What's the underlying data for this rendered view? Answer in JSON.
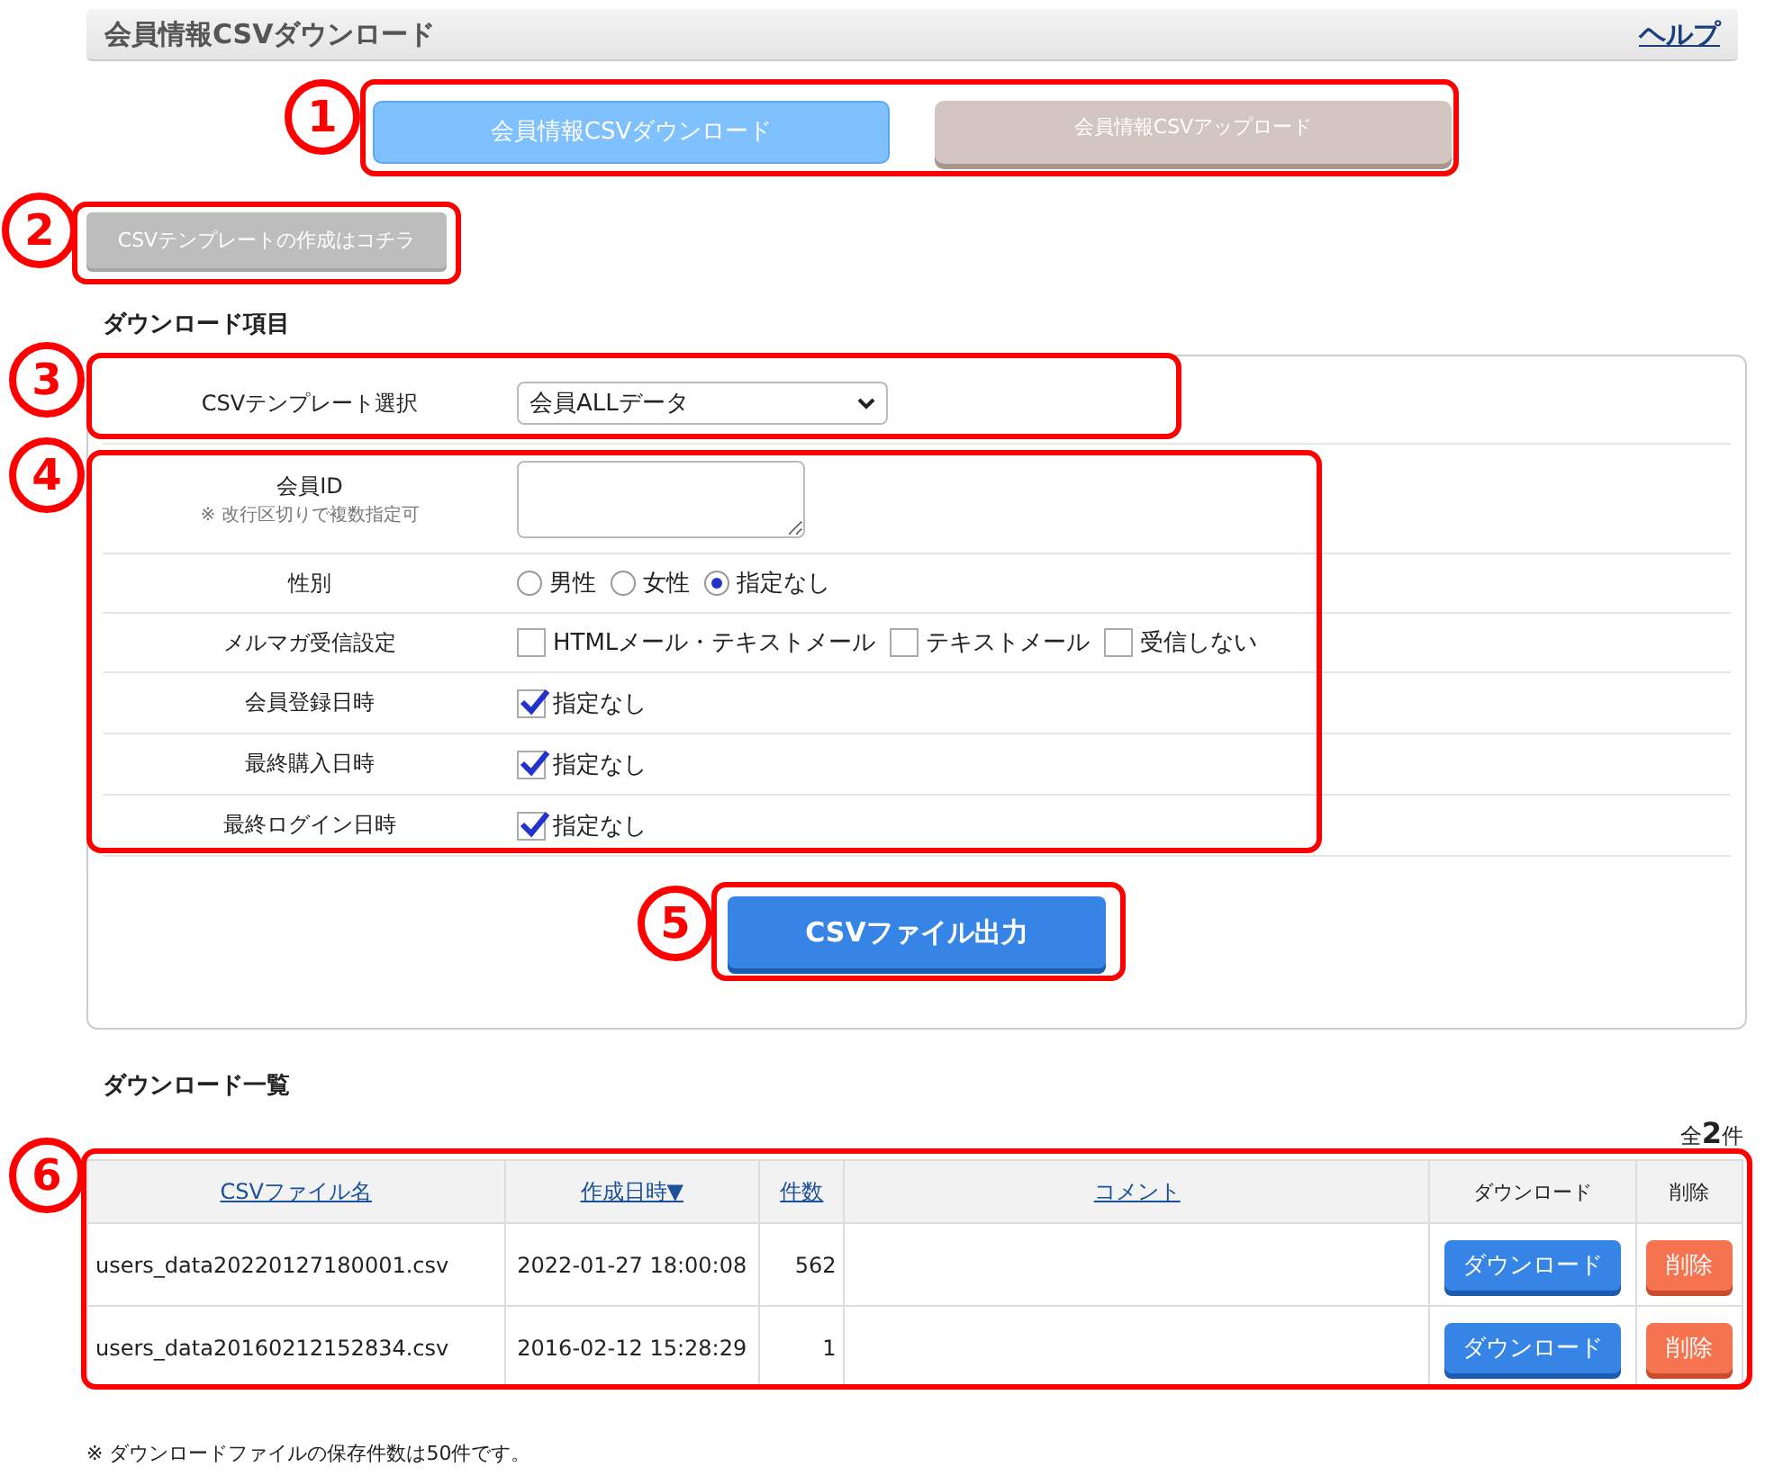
{
  "header": {
    "title": "会員情報CSVダウンロード",
    "help_link": "ヘルプ"
  },
  "tabs": [
    {
      "label": "会員情報CSVダウンロード",
      "selected": true
    },
    {
      "label": "会員情報CSVアップロード",
      "selected": false
    }
  ],
  "template_button": "CSVテンプレートの作成はコチラ",
  "download_items": {
    "heading": "ダウンロード項目",
    "template_select": {
      "label": "CSVテンプレート選択",
      "value": "会員ALLデータ"
    },
    "member_id": {
      "label": "会員ID",
      "note": "※ 改行区切りで複数指定可"
    },
    "gender": {
      "label": "性別",
      "options": [
        {
          "label": "男性",
          "selected": false
        },
        {
          "label": "女性",
          "selected": false
        },
        {
          "label": "指定なし",
          "selected": true
        }
      ]
    },
    "mail_setting": {
      "label": "メルマガ受信設定",
      "options": [
        {
          "label": "HTMLメール・テキストメール",
          "checked": false
        },
        {
          "label": "テキストメール",
          "checked": false
        },
        {
          "label": "受信しない",
          "checked": false
        }
      ]
    },
    "date_filters": [
      {
        "label": "会員登録日時",
        "option": "指定なし",
        "checked": true
      },
      {
        "label": "最終購入日時",
        "option": "指定なし",
        "checked": true
      },
      {
        "label": "最終ログイン日時",
        "option": "指定なし",
        "checked": true
      }
    ],
    "submit": "CSVファイル出力"
  },
  "download_list": {
    "heading": "ダウンロード一覧",
    "total": "全**2**件",
    "columns": [
      {
        "label": "CSVファイル名",
        "kind": "link"
      },
      {
        "label": "作成日時▼",
        "kind": "link"
      },
      {
        "label": "件数",
        "kind": "link"
      },
      {
        "label": "コメント",
        "kind": "link"
      },
      {
        "label": "ダウンロード",
        "kind": "text"
      },
      {
        "label": "削除",
        "kind": "text"
      }
    ],
    "rows": [
      {
        "file": "users_data20220127180001.csv",
        "created": "2022-01-27 18:00:08",
        "count": "562",
        "download": "ダウンロード",
        "delete": "削除"
      },
      {
        "file": "users_data20160212152834.csv",
        "created": "2016-02-12 15:28:29",
        "count": "1",
        "download": "ダウンロード",
        "delete": "削除"
      }
    ]
  },
  "footnote": "※ ダウンロードファイルの保存件数は50件です。",
  "annotations": [
    {
      "number": "1"
    },
    {
      "number": "2"
    },
    {
      "number": "3"
    },
    {
      "number": "4"
    },
    {
      "number": "5"
    },
    {
      "number": "6"
    }
  ]
}
